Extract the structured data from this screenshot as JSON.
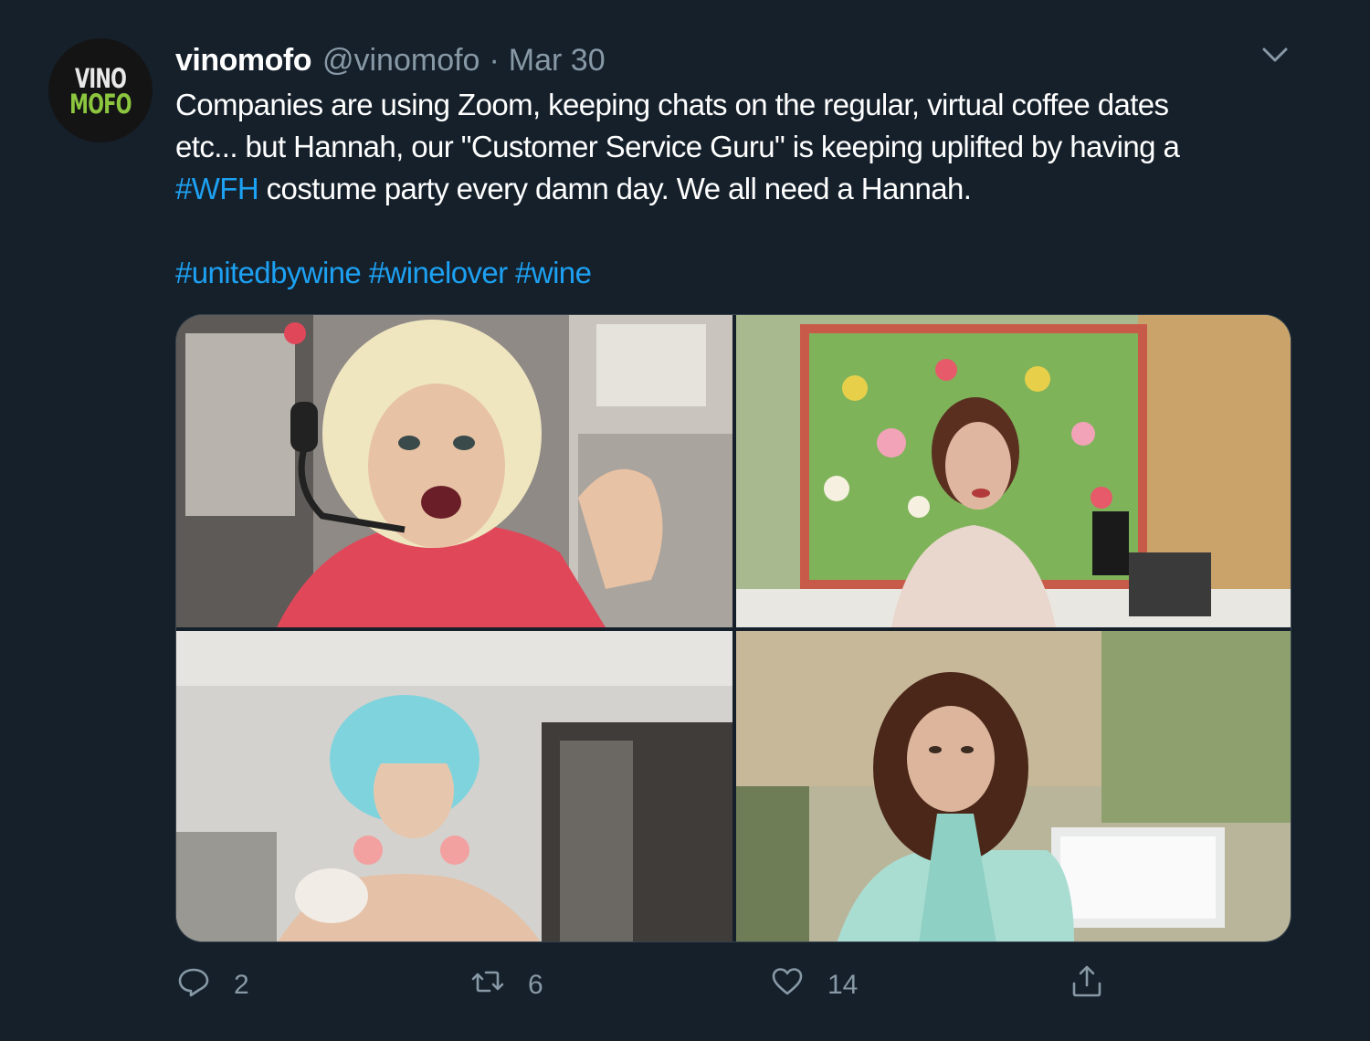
{
  "tweet": {
    "avatar": {
      "line1": "VINO",
      "line2": "MOFO",
      "accent": "#8cc63f"
    },
    "author_name": "vinomofo",
    "handle": "@vinomofo",
    "separator": "·",
    "date": "Mar 30",
    "menu_icon": "chevron-down-icon",
    "text": {
      "line1": "Companies are using Zoom, keeping chats on the regular, virtual coffee dates",
      "line2": "etc... but Hannah, our \"Customer Service Guru\" is keeping uplifted by having a",
      "line3_hashtag": "#WFH",
      "line3_rest": " costume party every damn day.  We all need a Hannah.",
      "tags": [
        "#unitedbywine",
        "#winelover",
        "#wine"
      ]
    },
    "media": {
      "photos": [
        {
          "description": "blonde-wig-headset-costume"
        },
        {
          "description": "flower-window-costume"
        },
        {
          "description": "blue-wig-costume"
        },
        {
          "description": "long-hair-teal-scarf"
        }
      ]
    },
    "actions": {
      "reply": {
        "icon": "reply-icon",
        "count": "2"
      },
      "retweet": {
        "icon": "retweet-icon",
        "count": "6"
      },
      "like": {
        "icon": "heart-icon",
        "count": "14"
      },
      "share": {
        "icon": "share-icon"
      }
    },
    "colors": {
      "background": "#15202b",
      "text": "#ffffff",
      "muted": "#8899a6",
      "link": "#1da1f2"
    }
  }
}
